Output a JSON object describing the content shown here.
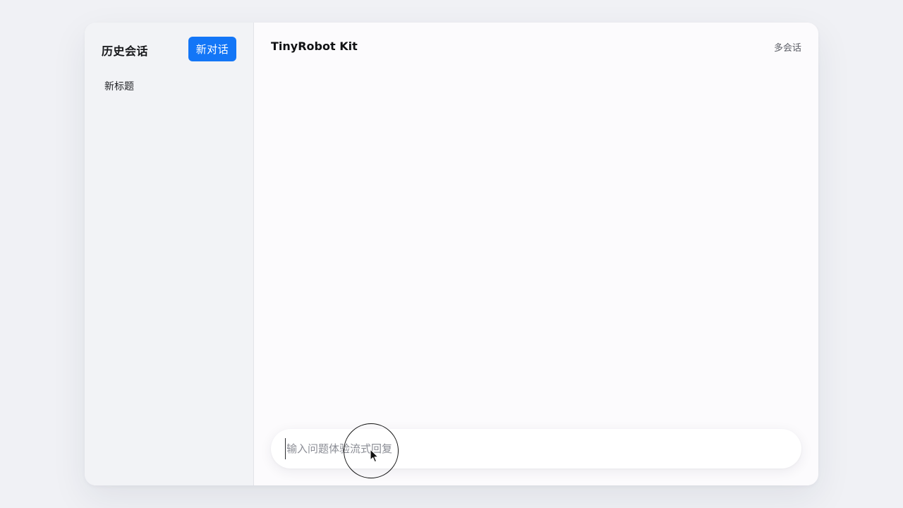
{
  "sidebar": {
    "title": "历史会话",
    "new_chat_label": "新对话",
    "items": [
      {
        "label": "新标题"
      }
    ]
  },
  "header": {
    "title": "TinyRobot Kit",
    "multi_session_label": "多会话"
  },
  "composer": {
    "placeholder": "输入问题体验流式回复",
    "value": ""
  },
  "colors": {
    "accent": "#1376f7",
    "sidebar_bg": "#f2f3f6",
    "page_bg": "#f0f1f5",
    "panel_bg": "#fcfbfd"
  }
}
